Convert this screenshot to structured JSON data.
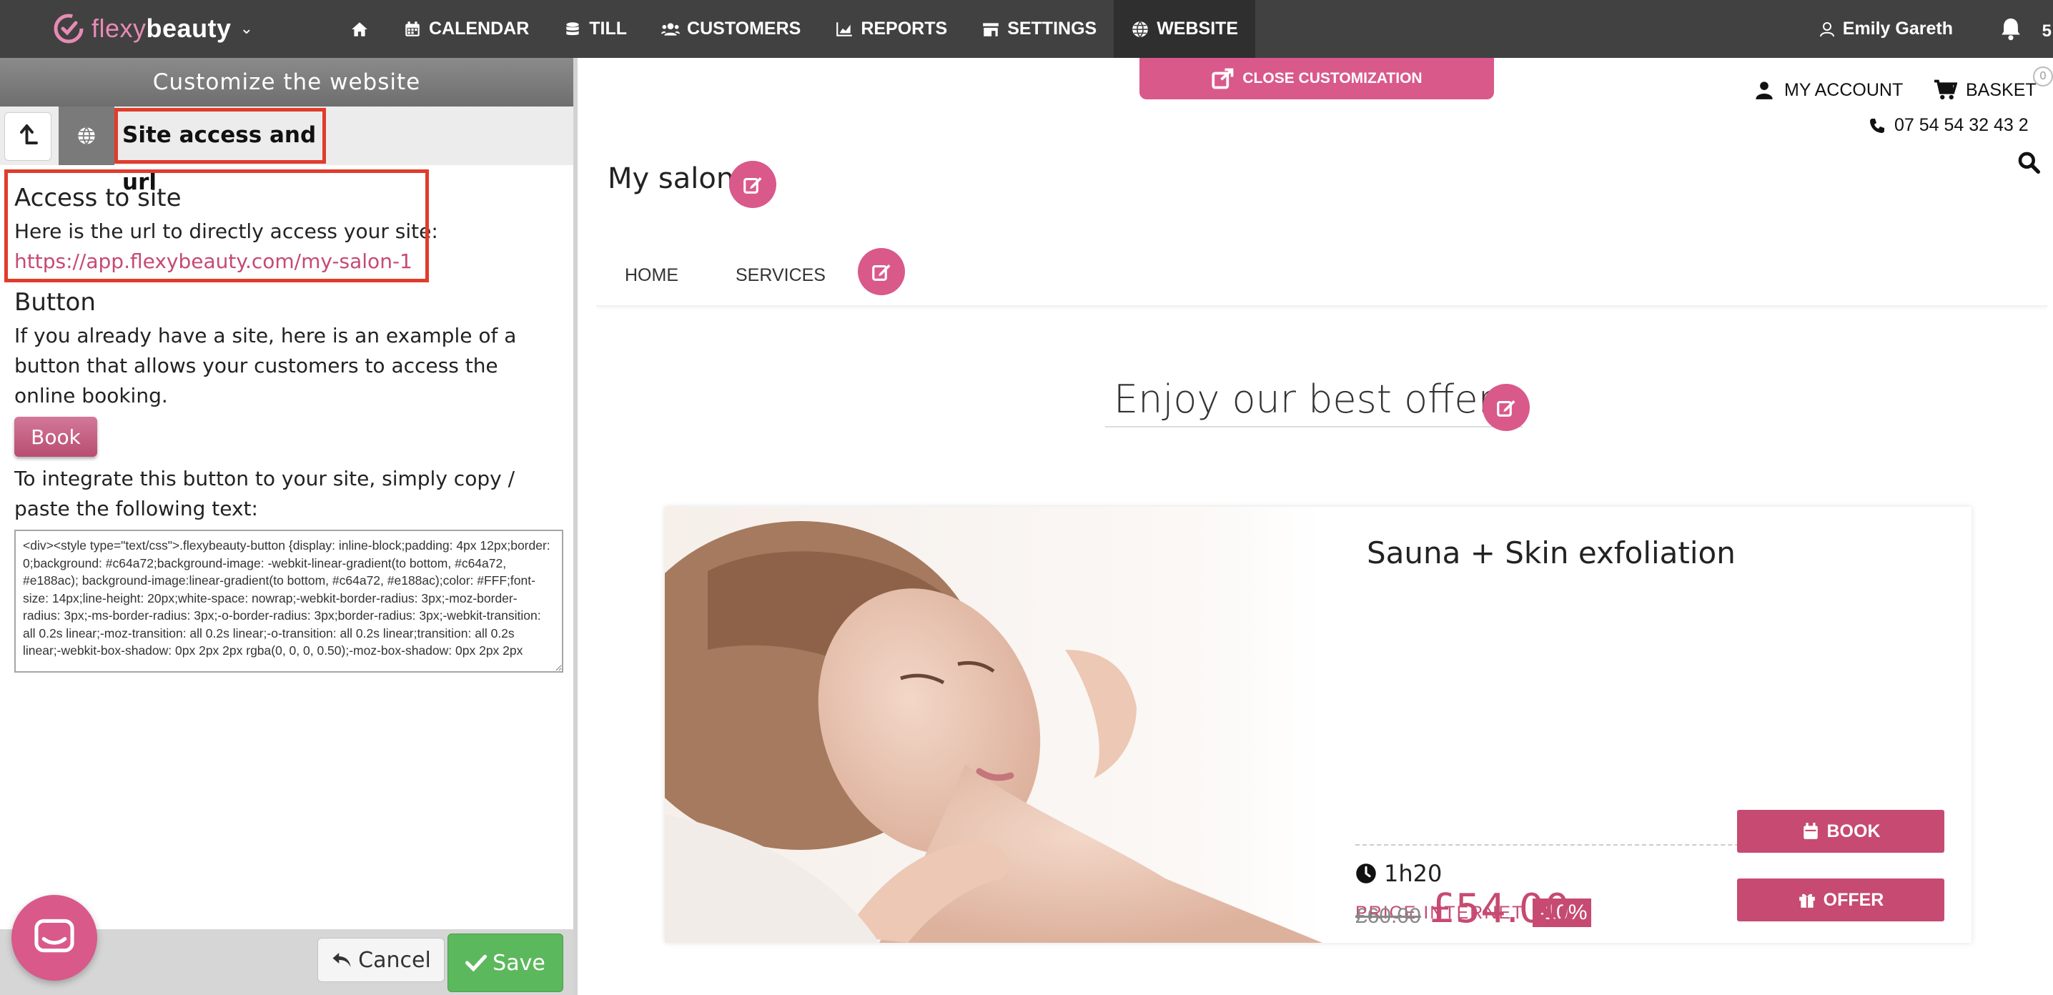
{
  "topbar": {
    "logo": {
      "part1": "flexy",
      "part2": "beauty"
    },
    "nav": [
      {
        "id": "home",
        "label": "",
        "icon": "home-icon"
      },
      {
        "id": "calendar",
        "label": "CALENDAR",
        "icon": "calendar-icon"
      },
      {
        "id": "till",
        "label": "TILL",
        "icon": "till-icon"
      },
      {
        "id": "customers",
        "label": "CUSTOMERS",
        "icon": "users-icon"
      },
      {
        "id": "reports",
        "label": "REPORTS",
        "icon": "chart-icon"
      },
      {
        "id": "settings",
        "label": "SETTINGS",
        "icon": "shop-icon"
      },
      {
        "id": "website",
        "label": "WEBSITE",
        "icon": "globe-icon",
        "active": true
      }
    ],
    "user_name": "Emily Gareth",
    "notification_count": "5"
  },
  "panel": {
    "header": "Customize the website",
    "crumb_title": "Site access and url",
    "access_title": "Access to site",
    "access_text": "Here is the url to directly access your site:",
    "site_url": "https://app.flexybeauty.com/my-salon-1",
    "button_title": "Button",
    "button_text": "If you already have a site, here is an example of a button that allows your customers to access the online booking.",
    "book_label": "Book",
    "integrate_text": "To integrate this button to your site, simply copy / paste the following text:",
    "code": "<div><style type=\"text/css\">.flexybeauty-button {display: inline-block;padding: 4px 12px;border: 0;background: #c64a72;background-image: -webkit-linear-gradient(to bottom, #c64a72, #e188ac); background-image:linear-gradient(to bottom, #c64a72, #e188ac);color: #FFF;font-size: 14px;line-height: 20px;white-space: nowrap;-webkit-border-radius: 3px;-moz-border-radius: 3px;-ms-border-radius: 3px;-o-border-radius: 3px;border-radius: 3px;-webkit-transition: all 0.2s linear;-moz-transition: all 0.2s linear;-o-transition: all 0.2s linear;transition: all 0.2s linear;-webkit-box-shadow: 0px 2px 2px rgba(0, 0, 0, 0.50);-moz-box-shadow: 0px 2px 2px",
    "cancel_label": "Cancel",
    "save_label": "Save"
  },
  "preview": {
    "close_label": "CLOSE CUSTOMIZATION",
    "my_account": "MY ACCOUNT",
    "basket": "BASKET",
    "basket_count": "0",
    "phone": "07 54 54 32 43 2",
    "salon_name": "My salon",
    "menu": [
      "HOME",
      "SERVICES"
    ],
    "offers_title": "Enjoy our best offers",
    "card": {
      "title": "Sauna + Skin exfoliation",
      "duration": "1h20",
      "price_label": "PRICE INTERNET",
      "discount": "-10%",
      "old_price": "£60.00",
      "new_price": "£54.00",
      "book_btn": "BOOK",
      "offer_btn": "OFFER"
    }
  },
  "colors": {
    "brand_pink": "#c64a72",
    "accent_pink": "#d9598b",
    "topbar": "#414141",
    "highlight_red": "#e03c2c",
    "save_green": "#5cb85c"
  }
}
